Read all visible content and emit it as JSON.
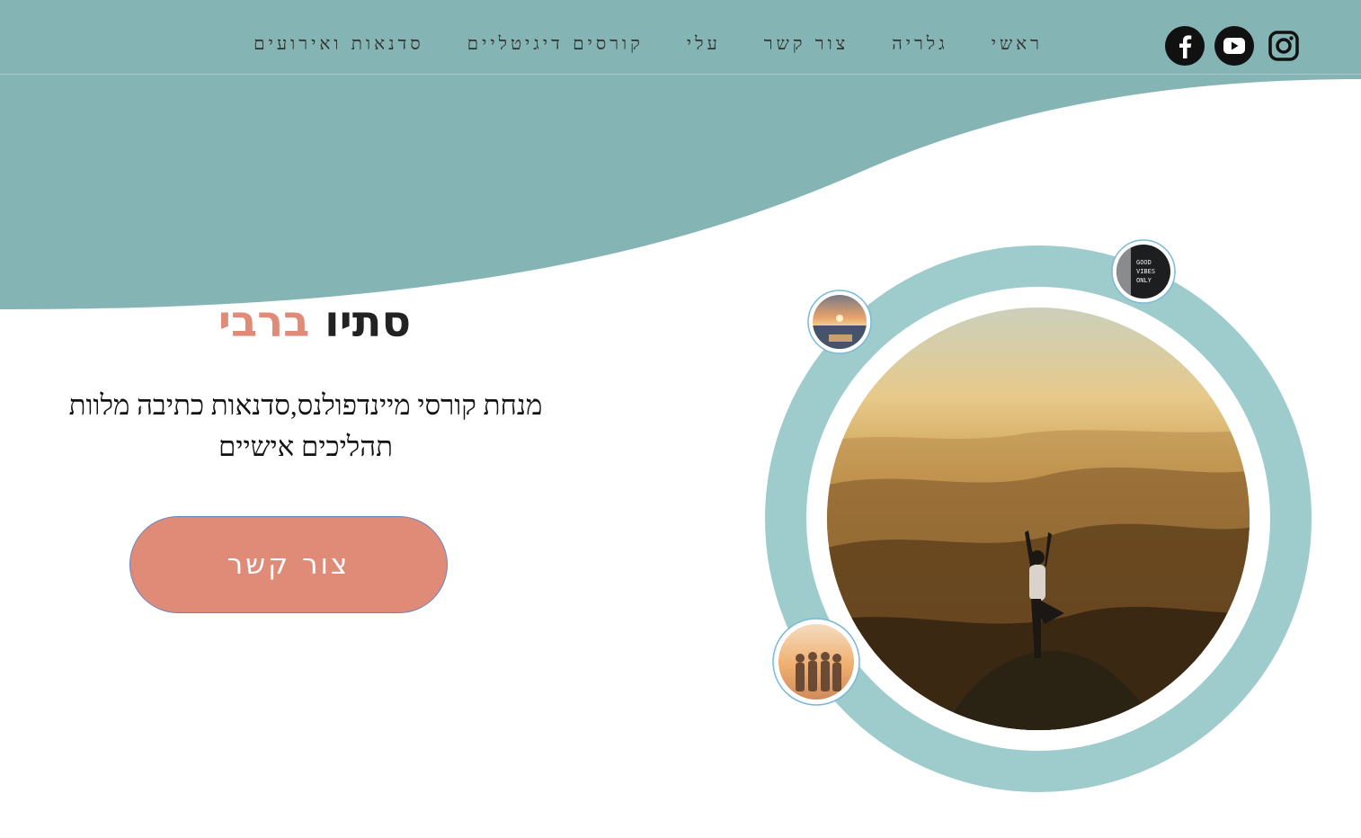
{
  "nav": {
    "items": [
      {
        "label": "ראשי"
      },
      {
        "label": "גלריה"
      },
      {
        "label": "צור קשר"
      },
      {
        "label": "עלי"
      },
      {
        "label": "קורסים דיגיטליים"
      },
      {
        "label": "סדנאות ואירועים"
      }
    ]
  },
  "social": [
    "instagram-icon",
    "youtube-icon",
    "facebook-icon"
  ],
  "hero": {
    "name_first": "סתיו",
    "name_last": "ברבי",
    "subtitle": "מנחת קורסי מיינדפולנס,סדנאות כתיבה מלוות תהליכים אישיים",
    "cta_label": "צור קשר"
  },
  "images": {
    "small_top": "GOOD VIBES ONLY"
  },
  "colors": {
    "teal": "#85b4b4",
    "ring": "#9ecbcb",
    "accent": "#e08a78",
    "text": "#222222"
  }
}
